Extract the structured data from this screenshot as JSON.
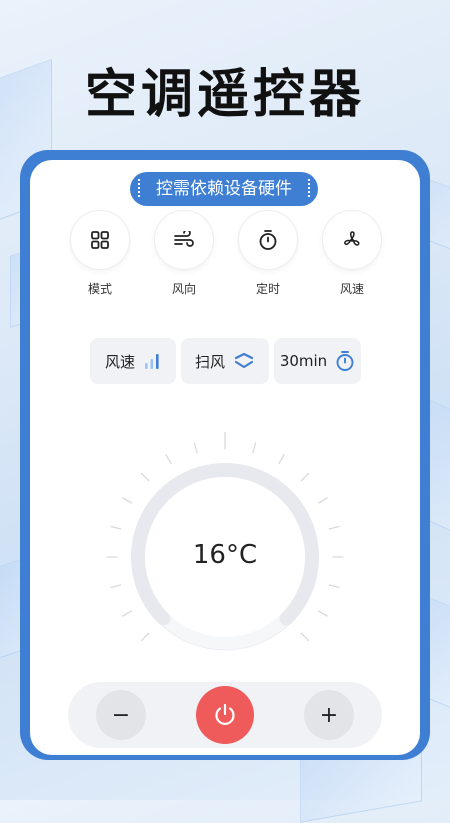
{
  "title": "空调遥控器",
  "marquee_text": "控需依赖设备硬件",
  "functions": [
    {
      "label": "模式",
      "icon": "grid-icon"
    },
    {
      "label": "风向",
      "icon": "wind-icon"
    },
    {
      "label": "定时",
      "icon": "timer-icon"
    },
    {
      "label": "风速",
      "icon": "fan-icon"
    }
  ],
  "status_chips": [
    {
      "label": "风速",
      "icon": "signal-bars-icon"
    },
    {
      "label": "扫风",
      "icon": "swing-arrows-icon"
    },
    {
      "label": "30min",
      "icon": "stopwatch-icon"
    }
  ],
  "temperature": "16°C",
  "controls": {
    "minus_label": "−",
    "plus_label": "+",
    "power_icon": "power-icon"
  },
  "colors": {
    "accent": "#3f7fd3",
    "power": "#ef5b5b"
  }
}
